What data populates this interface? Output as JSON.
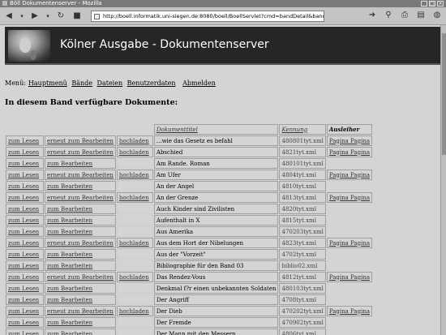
{
  "browser": {
    "window_title": "Böll Dokumentenserver - Mozilla",
    "url": "http://boell.informatik.uni-siegen.de:8080/boell/BoellServlet?cmd=bandDetail&bandID=2"
  },
  "banner": {
    "title": "Kölner Ausgabe - Dokumentenserver"
  },
  "menu": {
    "label": "Menü:",
    "items": [
      "Hauptmenü",
      "Bände",
      "Dateien",
      "Benutzerdaten",
      "Abmelden"
    ]
  },
  "page": {
    "heading": "In diesem Band verfügbare Dokumente:"
  },
  "table": {
    "headers": {
      "titel": "Dokumenttitel",
      "kennung": "Kennung",
      "ausleiher": "Ausleiher"
    },
    "rows": [
      {
        "lesen": "zum Lesen",
        "bearbeiten": "erneut zum Bearbeiten",
        "hochladen": "hochladen",
        "titel": "...wie das Gesetz es befahl",
        "kennung": "480801tyt.xml",
        "ausleiher": "Pagina Pagina"
      },
      {
        "lesen": "zum Lesen",
        "bearbeiten": "erneut zum Bearbeiten",
        "hochladen": "hochladen",
        "titel": "Abschied",
        "kennung": "4821tyt.xml",
        "ausleiher": "Pagina Pagina"
      },
      {
        "lesen": "zum Lesen",
        "bearbeiten": "zum Bearbeiten",
        "hochladen": "",
        "titel": "Am Rande. Roman",
        "kennung": "480101tyt.xml",
        "ausleiher": ""
      },
      {
        "lesen": "zum Lesen",
        "bearbeiten": "erneut zum Bearbeiten",
        "hochladen": "hochladen",
        "titel": "Am Ufer",
        "kennung": "4804tyt.xml",
        "ausleiher": "Pagina Pagina"
      },
      {
        "lesen": "zum Lesen",
        "bearbeiten": "zum Bearbeiten",
        "hochladen": "",
        "titel": "An der Angel",
        "kennung": "4810tyt.xml",
        "ausleiher": ""
      },
      {
        "lesen": "zum Lesen",
        "bearbeiten": "erneut zum Bearbeiten",
        "hochladen": "hochladen",
        "titel": "An der Grenze",
        "kennung": "4813tyt.xml",
        "ausleiher": "Pagina Pagina"
      },
      {
        "lesen": "zum Lesen",
        "bearbeiten": "zum Bearbeiten",
        "hochladen": "",
        "titel": "Auch Kinder sind Zivilisten",
        "kennung": "4820tyt.xml",
        "ausleiher": ""
      },
      {
        "lesen": "zum Lesen",
        "bearbeiten": "zum Bearbeiten",
        "hochladen": "",
        "titel": "Aufenthalt in X",
        "kennung": "4815tyt.xml",
        "ausleiher": ""
      },
      {
        "lesen": "zum Lesen",
        "bearbeiten": "zum Bearbeiten",
        "hochladen": "",
        "titel": "Aus Amerika",
        "kennung": "470203tyt.xml",
        "ausleiher": ""
      },
      {
        "lesen": "zum Lesen",
        "bearbeiten": "erneut zum Bearbeiten",
        "hochladen": "hochladen",
        "titel": "Aus dem Hort der Nibelungen",
        "kennung": "4823tyt.xml",
        "ausleiher": "Pagina Pagina"
      },
      {
        "lesen": "zum Lesen",
        "bearbeiten": "zum Bearbeiten",
        "hochladen": "",
        "titel": "Aus der \"Vorzeit\"",
        "kennung": "4702tyt.xml",
        "ausleiher": ""
      },
      {
        "lesen": "zum Lesen",
        "bearbeiten": "zum Bearbeiten",
        "hochladen": "",
        "titel": "Bibliographie für den Band 03",
        "kennung": "biblio02.xml",
        "ausleiher": ""
      },
      {
        "lesen": "zum Lesen",
        "bearbeiten": "erneut zum Bearbeiten",
        "hochladen": "hochladen",
        "titel": "Das Rendez-Vous",
        "kennung": "4812tyt.xml",
        "ausleiher": "Pagina Pagina"
      },
      {
        "lesen": "zum Lesen",
        "bearbeiten": "zum Bearbeiten",
        "hochladen": "",
        "titel": "Denkmal f?r einen unbekannten Soldaten",
        "kennung": "480103tyt.xml",
        "ausleiher": ""
      },
      {
        "lesen": "zum Lesen",
        "bearbeiten": "zum Bearbeiten",
        "hochladen": "",
        "titel": "Der Angriff",
        "kennung": "4708tyt.xml",
        "ausleiher": ""
      },
      {
        "lesen": "zum Lesen",
        "bearbeiten": "erneut zum Bearbeiten",
        "hochladen": "hochladen",
        "titel": "Der Dieb",
        "kennung": "470202tyt.xml",
        "ausleiher": "Pagina Pagina"
      },
      {
        "lesen": "zum Lesen",
        "bearbeiten": "zum Bearbeiten",
        "hochladen": "",
        "titel": "Der Fremde",
        "kennung": "470902tyt.xml",
        "ausleiher": ""
      },
      {
        "lesen": "zum Lesen",
        "bearbeiten": "zum Bearbeiten",
        "hochladen": "",
        "titel": "Der Mann mit den Messern",
        "kennung": "4806tyt.xml",
        "ausleiher": ""
      }
    ]
  }
}
